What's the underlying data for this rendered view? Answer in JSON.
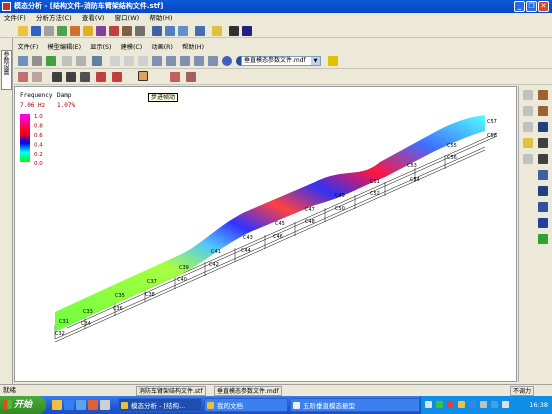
{
  "window": {
    "title": "模态分析 - [结构文件-消防车臂架结构文件.stf]",
    "minimize_glyph": "_",
    "restore_glyph": "❐",
    "close_glyph": "✕"
  },
  "menu": [
    "文件(F)",
    "分析方法(C)",
    "查看(V)",
    "窗口(W)",
    "帮助(H)"
  ],
  "inner_menu": [
    "文件(F)",
    "模型编辑(E)",
    "显示(S)",
    "建模(C)",
    "动画(R)",
    "帮助(H)"
  ],
  "left_tab_label": "参数设置",
  "mode_dropdown": {
    "value": "垂直模态参数文件.mdf"
  },
  "tooltip": "步进帧动",
  "legend": {
    "header_frequency": "Frequency",
    "header_damp": "Damp",
    "frequency": "7.06 Hz",
    "damp": "1.07%",
    "ticks": [
      "1.0",
      "0.8",
      "0.6",
      "0.4",
      "0.2",
      "0.0"
    ],
    "colors": [
      "#ff00c8",
      "#ff0000",
      "#ffff00",
      "#00ff00",
      "#00ffff",
      "#0000ff"
    ]
  },
  "nodes": [
    "C57",
    "C58",
    "C55",
    "C56",
    "C53",
    "C54",
    "C51",
    "C52",
    "C49",
    "C50",
    "C47",
    "C48",
    "C45",
    "C46",
    "C43",
    "C44",
    "C41",
    "C42",
    "C39",
    "C40",
    "C37",
    "C38",
    "C35",
    "C36",
    "C33",
    "C34",
    "C31",
    "C32"
  ],
  "status": {
    "left": "就绪",
    "file1": "消防车臂架结构文件.stf",
    "file2": "垂直模态参数文件.mdf",
    "right": "不调力"
  },
  "taskbar": {
    "start": "开始",
    "items": [
      "模态分析 - [结构...",
      "我的文档",
      "五阶垂直模态振型"
    ],
    "clock": "16:38"
  }
}
